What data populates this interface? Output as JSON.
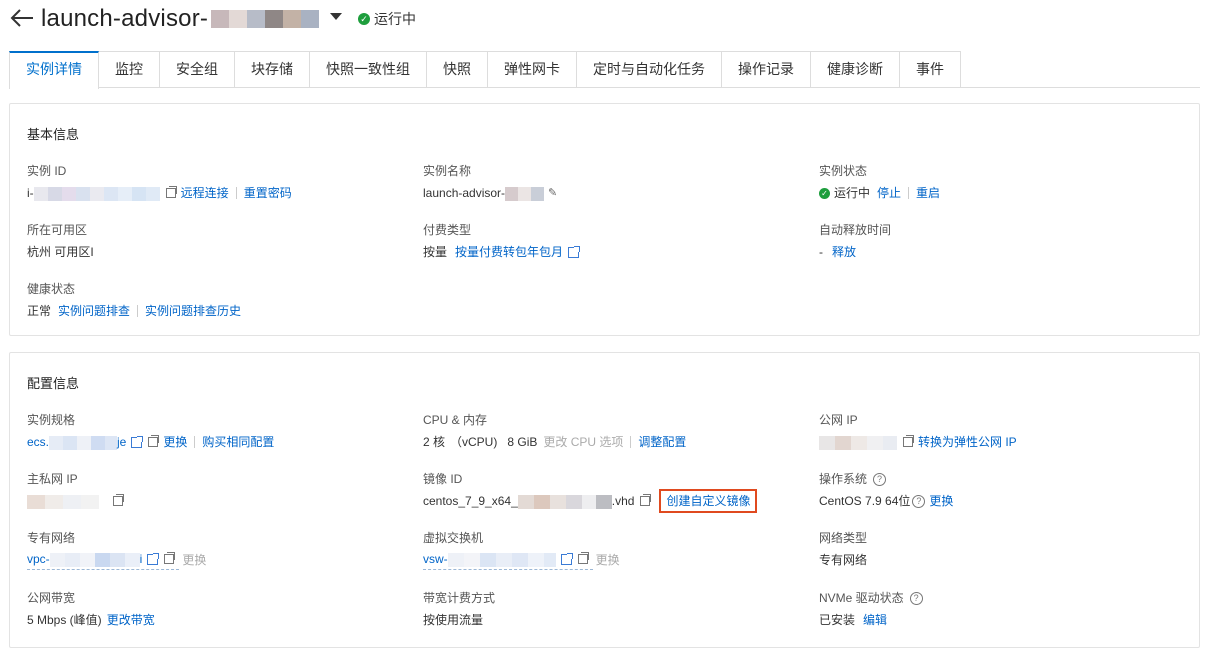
{
  "header": {
    "title": "launch-advisor-",
    "status": "运行中"
  },
  "tabs": [
    {
      "label": "实例详情"
    },
    {
      "label": "监控"
    },
    {
      "label": "安全组"
    },
    {
      "label": "块存储"
    },
    {
      "label": "快照一致性组"
    },
    {
      "label": "快照"
    },
    {
      "label": "弹性网卡"
    },
    {
      "label": "定时与自动化任务"
    },
    {
      "label": "操作记录"
    },
    {
      "label": "健康诊断"
    },
    {
      "label": "事件"
    }
  ],
  "basic": {
    "title": "基本信息",
    "instance_id": {
      "label": "实例 ID",
      "prefix": "i-",
      "remote": "远程连接",
      "reset_pwd": "重置密码"
    },
    "instance_name": {
      "label": "实例名称",
      "value": "launch-advisor-"
    },
    "instance_status": {
      "label": "实例状态",
      "value": "运行中",
      "stop": "停止",
      "restart": "重启"
    },
    "zone": {
      "label": "所在可用区",
      "value": "杭州 可用区I"
    },
    "billing": {
      "label": "付费类型",
      "value": "按量",
      "link": "按量付费转包年包月"
    },
    "release": {
      "label": "自动释放时间",
      "value": "-",
      "link": "释放"
    },
    "health": {
      "label": "健康状态",
      "value": "正常",
      "link1": "实例问题排查",
      "link2": "实例问题排查历史"
    }
  },
  "config": {
    "title": "配置信息",
    "spec": {
      "label": "实例规格",
      "prefix": "ecs.",
      "suffix": "je",
      "change": "更换",
      "buy_same": "购买相同配置"
    },
    "cpu_mem": {
      "label": "CPU & 内存",
      "cores": "2 核",
      "vcpu": "（vCPU)",
      "mem": "8 GiB",
      "change_cpu": "更改 CPU 选项",
      "adjust": "调整配置"
    },
    "public_ip": {
      "label": "公网 IP",
      "link": "转换为弹性公网 IP"
    },
    "private_ip": {
      "label": "主私网 IP"
    },
    "image_id": {
      "label": "镜像 ID",
      "prefix": "centos_7_9_x64_",
      "suffix": ".vhd",
      "create": "创建自定义镜像"
    },
    "os": {
      "label": "操作系统",
      "value": "CentOS 7.9 64位",
      "change": "更换"
    },
    "vpc": {
      "label": "专有网络",
      "prefix": "vpc-",
      "suffix": "i",
      "change": "更换"
    },
    "vswitch": {
      "label": "虚拟交换机",
      "prefix": "vsw-",
      "change": "更换"
    },
    "net_type": {
      "label": "网络类型",
      "value": "专有网络"
    },
    "bandwidth": {
      "label": "公网带宽",
      "value": "5 Mbps (峰值)",
      "change": "更改带宽"
    },
    "bw_billing": {
      "label": "带宽计费方式",
      "value": "按使用流量"
    },
    "nvme": {
      "label": "NVMe 驱动状态",
      "value": "已安装",
      "edit": "编辑"
    }
  },
  "colors": {
    "accent": "#0070cc",
    "link": "#0064c8",
    "running": "#1e9e3d",
    "highlight": "#e04a1f"
  }
}
